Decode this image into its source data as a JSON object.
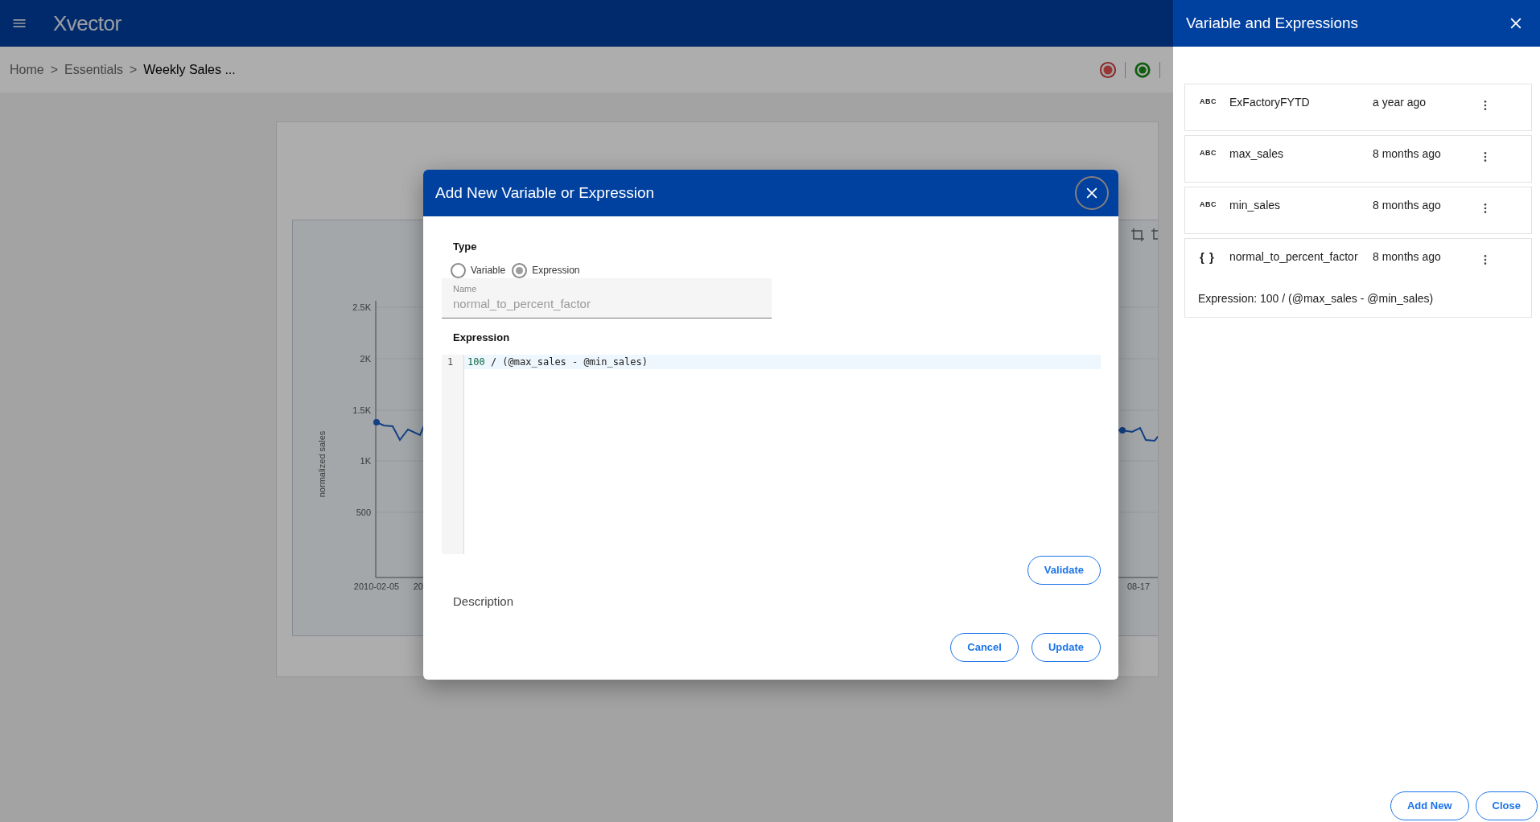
{
  "app_bar": {
    "logo": "Xvector"
  },
  "breadcrumb": {
    "separator": ">",
    "items": [
      {
        "label": "Home",
        "current": false
      },
      {
        "label": "Essentials",
        "current": false
      },
      {
        "label": "Weekly Sales ...",
        "current": true
      }
    ]
  },
  "chart_panel": {
    "y_axis_label": "normalized sales",
    "y_ticks": [
      "2.5K",
      "2K",
      "1.5K",
      "1K",
      "500"
    ],
    "x_labels": [
      "2010-02-05",
      "20",
      "08-17"
    ]
  },
  "modal": {
    "title": "Add New Variable or Expression",
    "type_label": "Type",
    "type_options": [
      {
        "label": "Variable",
        "selected": false
      },
      {
        "label": "Expression",
        "selected": true
      }
    ],
    "name_field": {
      "label": "Name",
      "value": "normal_to_percent_factor",
      "disabled": true
    },
    "expression_label": "Expression",
    "editor": {
      "lines": [
        {
          "number": "1",
          "code": "100 / (@max_sales - @min_sales)",
          "highlighted": true
        }
      ]
    },
    "validate_button": "Validate",
    "description_label": "Description",
    "buttons": [
      "Cancel",
      "Update"
    ]
  },
  "drawer": {
    "title": "Variable and Expressions",
    "items": [
      {
        "kind": "variable",
        "icon": "ABC",
        "name": "ExFactoryFYTD",
        "updated": "a year ago"
      },
      {
        "kind": "variable",
        "icon": "ABC",
        "name": "max_sales",
        "updated": "8 months ago"
      },
      {
        "kind": "variable",
        "icon": "ABC",
        "name": "min_sales",
        "updated": "8 months ago"
      },
      {
        "kind": "expression",
        "icon": "{ }",
        "name": "normal_to_percent_factor",
        "updated": "8 months ago",
        "expression": "Expression: 100 / (@max_sales - @min_sales)"
      }
    ],
    "buttons": [
      "Add New",
      "Close"
    ]
  }
}
